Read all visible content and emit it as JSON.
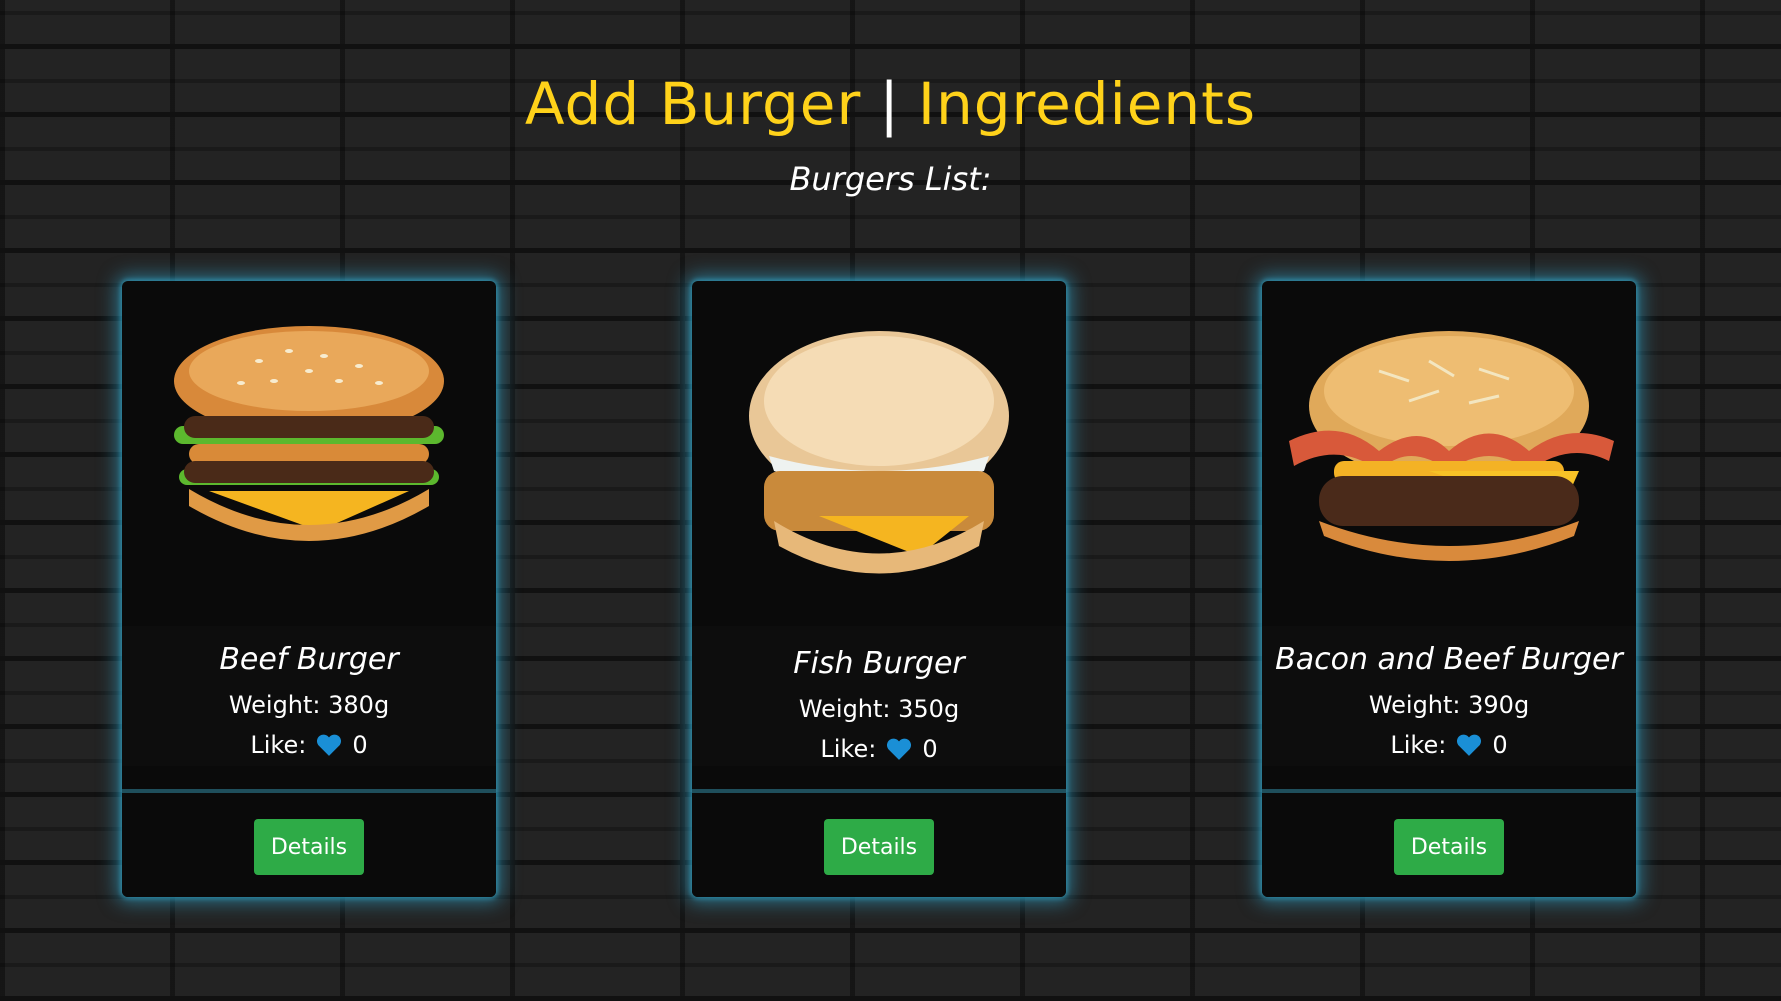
{
  "header": {
    "add_burger": "Add Burger",
    "separator": "|",
    "ingredients": "Ingredients",
    "subtitle": "Burgers List:"
  },
  "colors": {
    "accent": "#ffd21a",
    "glow": "#32aad2",
    "button": "#2eab47",
    "heart": "#1a8fd6"
  },
  "burgers": [
    {
      "name": "Beef Burger",
      "weight": "Weight: 380g",
      "like_label": "Like:",
      "likes": "0",
      "button": "Details",
      "image": "big-mac-burger-image"
    },
    {
      "name": "Fish Burger",
      "weight": "Weight: 350g",
      "like_label": "Like:",
      "likes": "0",
      "button": "Details",
      "image": "fish-burger-image"
    },
    {
      "name": "Bacon and Beef Burger",
      "weight": "Weight: 390g",
      "like_label": "Like:",
      "likes": "0",
      "button": "Details",
      "image": "bacon-beef-burger-image"
    }
  ]
}
